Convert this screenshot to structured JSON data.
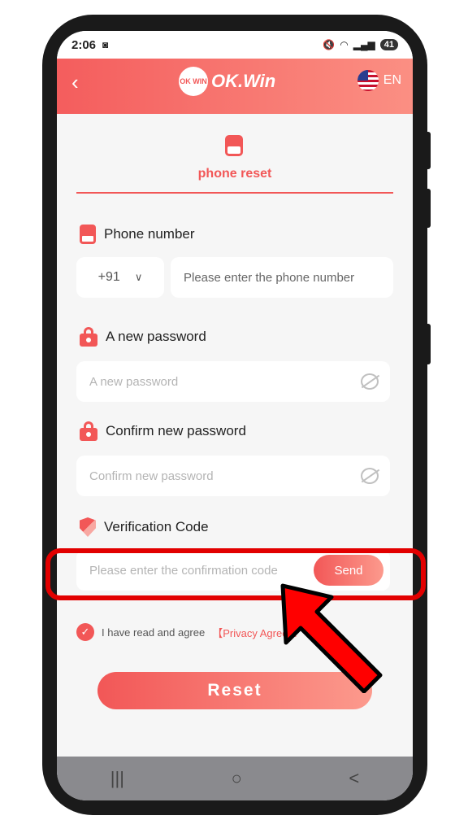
{
  "status": {
    "time": "2:06",
    "battery": "41"
  },
  "header": {
    "back_icon": "back-chevron-icon",
    "brand": "OK.Win",
    "logo_mark": "OK WIN",
    "language": "EN"
  },
  "tab": {
    "title": "phone reset"
  },
  "phone": {
    "label": "Phone number",
    "country_code": "+91",
    "placeholder": "Please enter the phone number"
  },
  "new_password": {
    "label": "A new password",
    "placeholder": "A new password"
  },
  "confirm_password": {
    "label": "Confirm new password",
    "placeholder": "Confirm new password"
  },
  "verification": {
    "label": "Verification Code",
    "placeholder": "Please enter the confirmation code",
    "send_label": "Send"
  },
  "agreement": {
    "text": "I have read and agree",
    "link": "【Privacy Agreem"
  },
  "reset_label": "Reset",
  "navbar": {
    "recents": "|||",
    "home": "○",
    "back": "<"
  },
  "colors": {
    "accent": "#f25757",
    "highlight": "#e20000"
  }
}
